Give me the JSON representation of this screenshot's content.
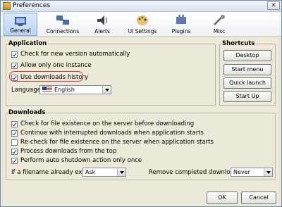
{
  "window": {
    "title": "Preferences",
    "close_glyph": "✕"
  },
  "toolbar": {
    "tabs": [
      {
        "label": "General",
        "icon": "general-icon",
        "selected": true
      },
      {
        "label": "Connections",
        "icon": "connections-icon"
      },
      {
        "label": "Alerts",
        "icon": "alerts-icon"
      },
      {
        "label": "UI Settings",
        "icon": "ui-settings-icon"
      },
      {
        "label": "Plugins",
        "icon": "plugins-icon"
      },
      {
        "label": "Misc",
        "icon": "misc-icon"
      }
    ]
  },
  "application": {
    "title": "Application",
    "options": [
      {
        "label": "Check for new version automatically",
        "checked": true
      },
      {
        "label": "Allow only one instance",
        "checked": true
      },
      {
        "label": "Use downloads history",
        "checked": true
      }
    ],
    "language_label": "Language",
    "language_value": "English"
  },
  "shortcuts": {
    "title": "Shortcuts",
    "buttons": [
      "Desktop",
      "Start menu",
      "Quick launch",
      "Start Up"
    ]
  },
  "downloads": {
    "title": "Downloads",
    "options": [
      {
        "label": "Check for file existence on the server before downloading",
        "checked": true
      },
      {
        "label": "Continue with interrupted downloads when application starts",
        "checked": true
      },
      {
        "label": "Re-check for file existence on the server when application starts",
        "checked": false
      },
      {
        "label": "Process downloads from the top",
        "checked": true
      },
      {
        "label": "Perform auto shutdown action only once",
        "checked": true
      }
    ],
    "filename_exists_label": "If a filename already exists:",
    "filename_exists_value": "Ask",
    "remove_completed_label": "Remove completed downloads",
    "remove_completed_value": "Never"
  },
  "footer": {
    "ok_label": "OK",
    "cancel_label": "Cancel"
  },
  "colors": {
    "highlight_ring": "#d9383b",
    "selected_tab": "#b9d2f2"
  }
}
